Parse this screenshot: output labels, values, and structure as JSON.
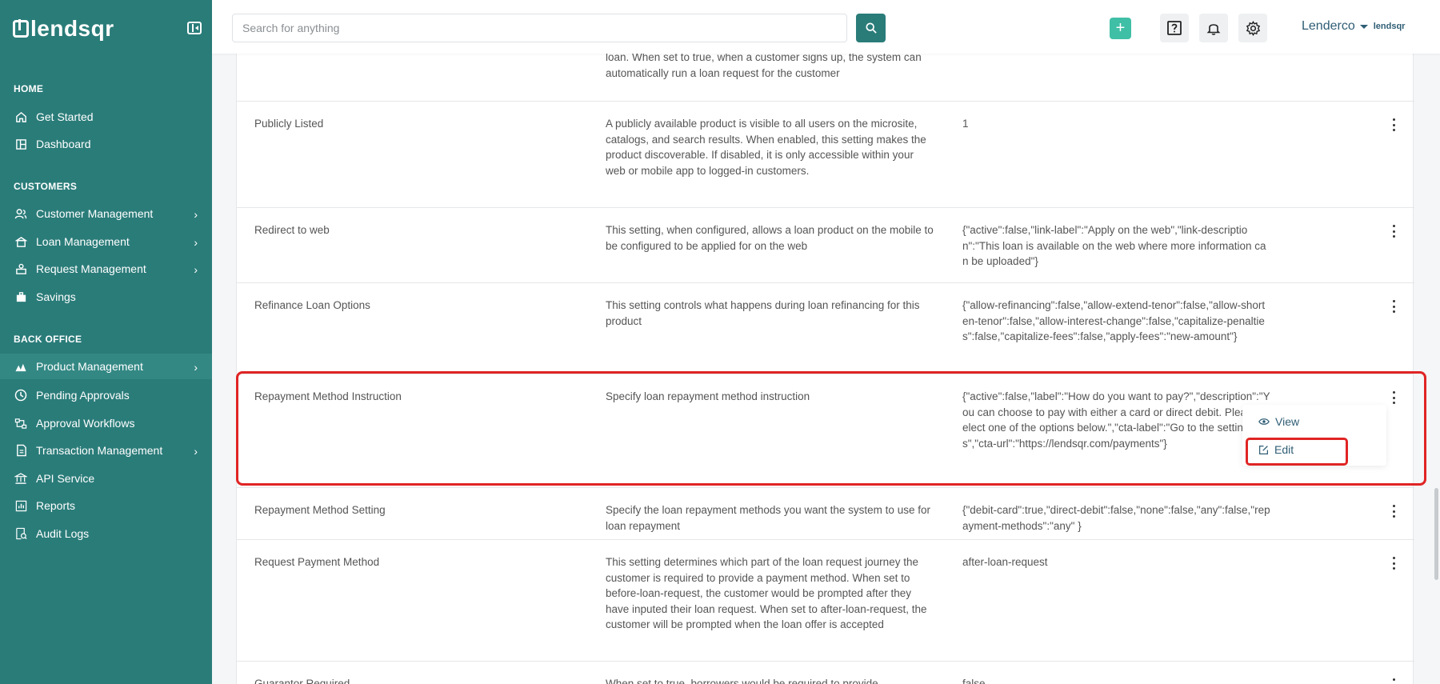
{
  "app": {
    "logo_text": "lendsqr"
  },
  "search": {
    "placeholder": "Search for anything"
  },
  "header": {
    "org_name": "Lenderco",
    "org_logo_text": "lendsqr"
  },
  "sidebar": {
    "sections": {
      "home": "HOME",
      "customers": "CUSTOMERS",
      "back_office": "BACK OFFICE"
    },
    "items": [
      {
        "label": "Get Started",
        "icon": "home-icon"
      },
      {
        "label": "Dashboard",
        "icon": "dashboard-icon"
      },
      {
        "label": "Customer Management",
        "icon": "users-icon"
      },
      {
        "label": "Loan Management",
        "icon": "loan-icon"
      },
      {
        "label": "Request Management",
        "icon": "request-icon"
      },
      {
        "label": "Savings",
        "icon": "briefcase-icon"
      },
      {
        "label": "Product Management",
        "icon": "product-icon"
      },
      {
        "label": "Pending Approvals",
        "icon": "clock-icon"
      },
      {
        "label": "Approval Workflows",
        "icon": "workflow-icon"
      },
      {
        "label": "Transaction Management",
        "icon": "transaction-icon"
      },
      {
        "label": "API Service",
        "icon": "bank-icon"
      },
      {
        "label": "Reports",
        "icon": "chart-icon"
      },
      {
        "label": "Audit Logs",
        "icon": "audit-icon"
      }
    ]
  },
  "table": {
    "rows": [
      {
        "name": "",
        "description": "loan. When set to true, when a customer signs up, the system can automatically run a loan request for the customer",
        "value": ""
      },
      {
        "name": "Publicly Listed",
        "description": "A publicly available product is visible to all users on the microsite, catalogs, and search results. When enabled, this setting makes the product discoverable. If disabled, it is only accessible within your web or mobile app to logged-in customers.",
        "value": "1"
      },
      {
        "name": "Redirect to web",
        "description": "This setting, when configured, allows a loan product on the mobile to be configured to be applied for on the web",
        "value": "{\"active\":false,\"link-label\":\"Apply on the web\",\"link-description\":\"This loan is available on the web where more information can be uploaded\"}"
      },
      {
        "name": "Refinance Loan Options",
        "description": "This setting controls what happens during loan refinancing for this product",
        "value": "{\"allow-refinancing\":false,\"allow-extend-tenor\":false,\"allow-shorten-tenor\":false,\"allow-interest-change\":false,\"capitalize-penalties\":false,\"capitalize-fees\":false,\"apply-fees\":\"new-amount\"}"
      },
      {
        "name": "Repayment Method Instruction",
        "description": "Specify loan repayment method instruction",
        "value": "{\"active\":false,\"label\":\"How do you want to pay?\",\"description\":\"You can choose to pay with either a card or direct debit. Please select one of the options below.\",\"cta-label\":\"Go to the settings\",\"cta-url\":\"https://lendsqr.com/payments\"}"
      },
      {
        "name": "Repayment Method Setting",
        "description": "Specify the loan repayment methods you want the system to use for loan repayment",
        "value": "{\"debit-card\":true,\"direct-debit\":false,\"none\":false,\"any\":false,\"repayment-methods\":\"any\" }"
      },
      {
        "name": "Request Payment Method",
        "description": "This setting determines which part of the loan request journey the customer is required to provide a payment method. When set to before-loan-request, the customer would be prompted after they have inputed their loan request. When set to after-loan-request, the customer will be prompted when the loan offer is accepted",
        "value": "after-loan-request"
      },
      {
        "name": "Guarantor Required",
        "description": "When set to true, borrowers would be required to provide",
        "value": "false"
      }
    ]
  },
  "row_menu": {
    "view_label": "View",
    "edit_label": "Edit"
  },
  "colors": {
    "sidebar": "#2a7c79",
    "accent": "#3fbfa6",
    "highlight": "#e02424"
  }
}
